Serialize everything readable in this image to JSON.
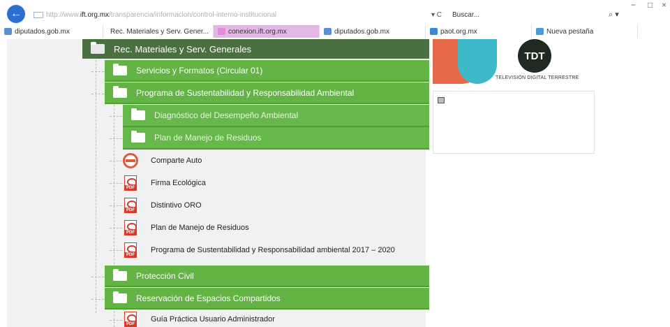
{
  "browser": {
    "url_host": "ift.org.mx",
    "url_prefix": "http://www.",
    "url_rest": "/transparencia/informacion/control-interno-institucional",
    "refresh_label": "▾ C",
    "search_placeholder": "Buscar...",
    "search_icon": "search-icon",
    "back_icon": "back-arrow-icon",
    "window_controls": [
      "−",
      "□",
      "×"
    ],
    "tabs": [
      {
        "label": "diputados.gob.mx",
        "icon_color": "#5a8fd6",
        "active": false
      },
      {
        "label": "Rec. Materiales y Serv. Gener...",
        "icon_color": "#9bb6d8",
        "active": false
      },
      {
        "label": "conexion.ift.org.mx",
        "icon_color": "#e28bd9",
        "active": true
      },
      {
        "label": "diputados.gob.mx",
        "icon_color": "#5a8fd6",
        "active": false
      },
      {
        "label": "paot.org.mx",
        "icon_color": "#3a89d6",
        "active": false
      },
      {
        "label": "Nueva pestaña",
        "icon_color": "#4a9ad8",
        "active": false
      }
    ]
  },
  "tree": {
    "root": {
      "label": "Rec. Materiales y Serv. Generales"
    },
    "servicios": {
      "label": "Servicios y Formatos (Circular 01)"
    },
    "programa": {
      "label": "Programa de Sustentabilidad y Responsabilidad Ambiental"
    },
    "diagnostico": {
      "label": "Diagnóstico del Desempeño Ambiental"
    },
    "plan_manejo": {
      "label": "Plan de Manejo de Residuos"
    },
    "leaves": [
      {
        "label": "Comparte Auto",
        "icon": "car-share-icon"
      },
      {
        "label": "Firma Ecológica",
        "icon": "pdf-icon"
      },
      {
        "label": "Distintivo ORO",
        "icon": "pdf-icon"
      },
      {
        "label": "Plan de Manejo de Residuos",
        "icon": "pdf-icon"
      },
      {
        "label": "Programa de Sustentabilidad y Responsabilidad ambiental 2017 – 2020",
        "icon": "pdf-icon"
      }
    ],
    "proteccion": {
      "label": "Protección Civil"
    },
    "reservacion": {
      "label": "Reservación de Espacios Compartidos"
    },
    "guia": {
      "label": "Guía Práctica Usuario Administrador",
      "icon": "pdf-icon"
    }
  },
  "sidebar": {
    "banner_logo": "TDT",
    "banner_caption": "TELEVISIÓN DIGITAL TERRESTRE",
    "image_icon": "image-placeholder-icon"
  },
  "colors": {
    "root_green": "#4a7040",
    "node_green": "#63b445",
    "pdf_red": "#d53a2a",
    "back_blue": "#2a6fd1"
  }
}
